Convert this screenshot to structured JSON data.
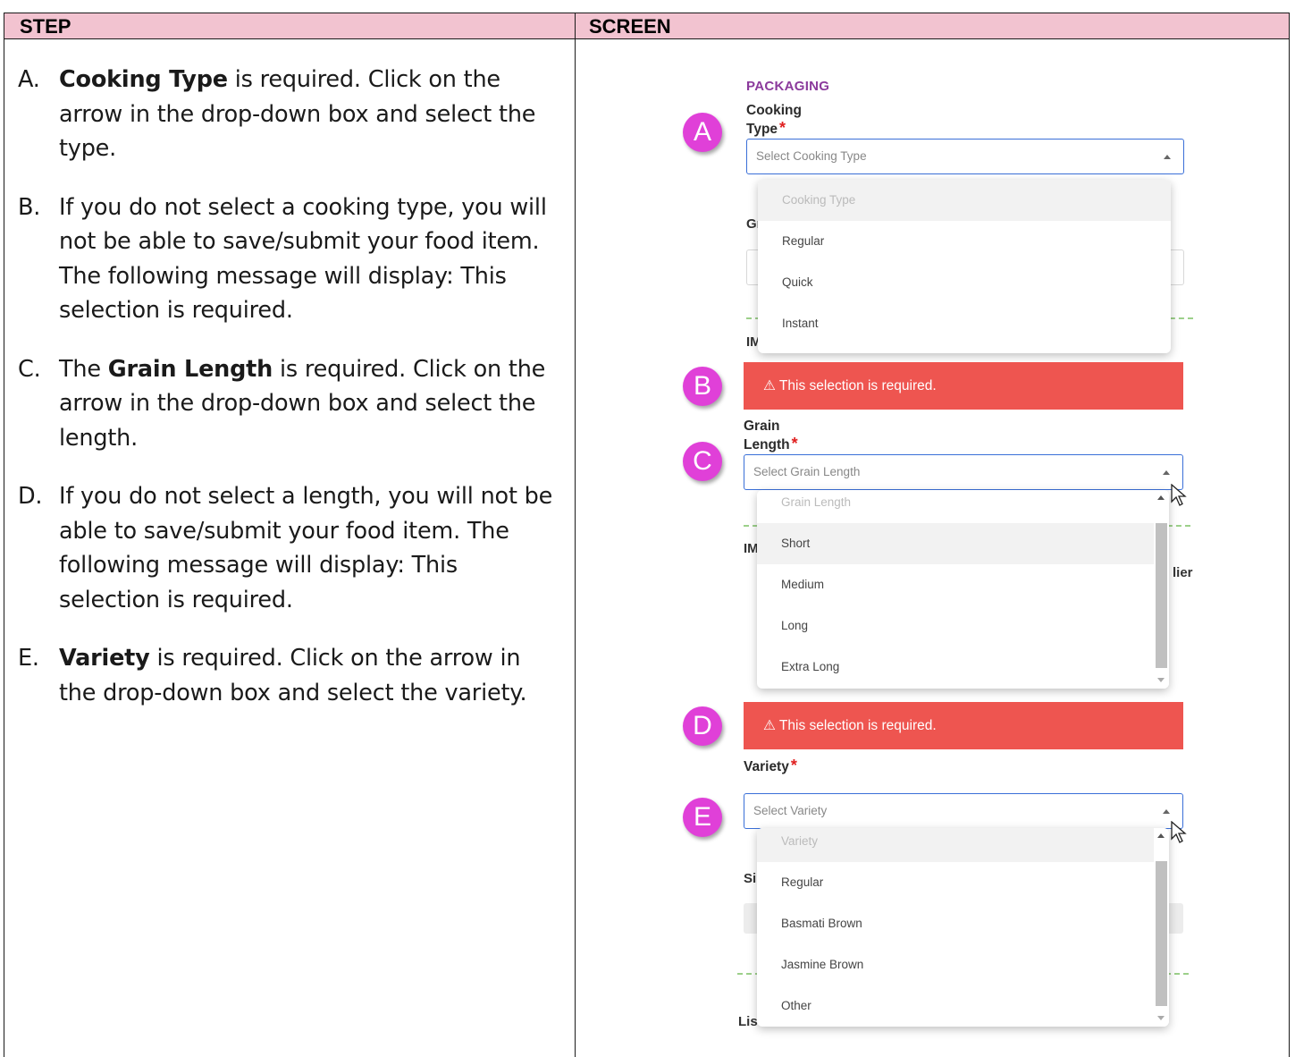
{
  "table": {
    "col_step": "STEP",
    "col_screen": "SCREEN"
  },
  "steps": [
    {
      "letter": "A.",
      "segments": [
        {
          "text": "Cooking Type",
          "bold": true
        },
        {
          "text": " is required.  Click on the arrow in the drop-down box and select the type.",
          "bold": false
        }
      ]
    },
    {
      "letter": "B.",
      "segments": [
        {
          "text": "If you do not select a cooking type, you will not be able to save/submit your food item. The following message will display: This selection is required.",
          "bold": false
        }
      ]
    },
    {
      "letter": "C.",
      "segments": [
        {
          "text": "The ",
          "bold": false
        },
        {
          "text": "Grain Length",
          "bold": true
        },
        {
          "text": " is required.  Click on the arrow in the drop-down box and select the length.",
          "bold": false
        }
      ]
    },
    {
      "letter": "D.",
      "segments": [
        {
          "text": "If you do not select a length, you will not be able to save/submit your food item.  The following message will display:  This selection is required.",
          "bold": false
        }
      ]
    },
    {
      "letter": "E.",
      "segments": [
        {
          "text": "Variety",
          "bold": true
        },
        {
          "text": " is required.  Click on the arrow in the drop-down box and select the variety.",
          "bold": false
        }
      ]
    }
  ],
  "screen": {
    "section_title": "PACKAGING",
    "badges": {
      "a": "A",
      "b": "B",
      "c": "C",
      "d": "D",
      "e": "E"
    },
    "required_mark": "*",
    "cooking": {
      "label": "Cooking Type",
      "placeholder": "Select Cooking Type",
      "options": [
        "Cooking Type",
        "Regular",
        "Quick",
        "Instant"
      ]
    },
    "error_text": "⚠ This selection is required.",
    "grain": {
      "label": "Grain Length",
      "placeholder": "Select Grain Length",
      "options": [
        "Grain Length",
        "Short",
        "Medium",
        "Long",
        "Extra Long"
      ],
      "highlighted": "Short"
    },
    "variety": {
      "label": "Variety",
      "placeholder": "Select Variety",
      "options": [
        "Variety",
        "Regular",
        "Basmati Brown",
        "Jasmine Brown",
        "Other"
      ]
    },
    "fragments": {
      "gr": "Gr",
      "im1": "IM",
      "im2": "IM",
      "lier": "lier",
      "si": "Si",
      "lis": "Lis"
    }
  }
}
